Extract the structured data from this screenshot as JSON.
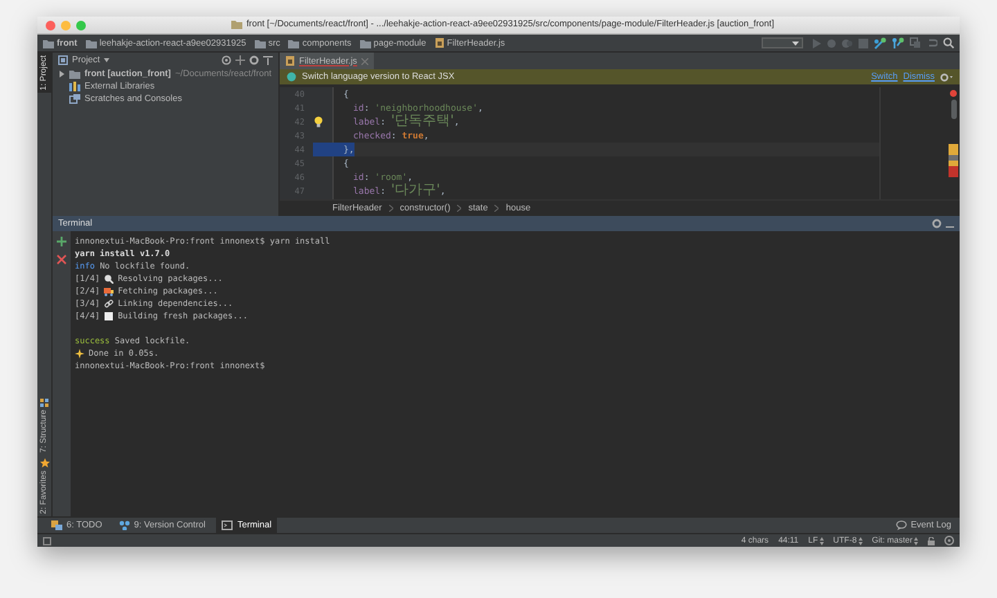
{
  "window": {
    "title": "front [~/Documents/react/front] - .../leehakje-action-react-a9ee02931925/src/components/page-module/FilterHeader.js [auction_front]"
  },
  "navigation_bar": [
    "front",
    "leehakje-action-react-a9ee02931925",
    "src",
    "components",
    "page-module",
    "FilterHeader.js"
  ],
  "left_strip": [
    {
      "label": "1: Project",
      "selected": true
    },
    {
      "label": "7: Structure",
      "selected": false
    },
    {
      "label": "2: Favorites",
      "selected": false
    }
  ],
  "project_panel": {
    "title": "Project",
    "items": [
      {
        "label": "front [auction_front]",
        "path": "~/Documents/react/front",
        "expanded": false,
        "kind": "folder"
      },
      {
        "label": "External Libraries",
        "kind": "library"
      },
      {
        "label": "Scratches and Consoles",
        "kind": "scratch"
      }
    ]
  },
  "editor": {
    "tabs": [
      {
        "label": "FilterHeader.js",
        "selected": true
      }
    ],
    "notification": {
      "text": "Switch language version to React JSX",
      "actions": [
        "Switch",
        "Dismiss"
      ]
    },
    "lines": [
      {
        "number": "40",
        "kind": "brace",
        "tokens": [
          {
            "kind": "punct",
            "text": "{"
          }
        ]
      },
      {
        "number": "41",
        "kind": "property",
        "tokens": [
          {
            "kind": "prop",
            "text": "id"
          },
          {
            "kind": "punct",
            "text": ": "
          },
          {
            "kind": "string",
            "text": "'neighborhoodhouse'"
          },
          {
            "kind": "punct",
            "text": ","
          }
        ]
      },
      {
        "number": "42",
        "kind": "property",
        "tokens": [
          {
            "kind": "prop",
            "text": "label"
          },
          {
            "kind": "punct",
            "text": ": "
          },
          {
            "kind": "string",
            "text": "'단독주택'"
          },
          {
            "kind": "punct",
            "text": ","
          }
        ],
        "bulb": true
      },
      {
        "number": "43",
        "kind": "property",
        "tokens": [
          {
            "kind": "prop",
            "text": "checked"
          },
          {
            "kind": "punct",
            "text": ": "
          },
          {
            "kind": "keyword",
            "text": "true"
          },
          {
            "kind": "punct",
            "text": ","
          }
        ]
      },
      {
        "number": "44",
        "kind": "brace",
        "tokens": [
          {
            "kind": "punct",
            "text": "},"
          }
        ],
        "highlighted": true
      },
      {
        "number": "45",
        "kind": "brace",
        "tokens": [
          {
            "kind": "punct",
            "text": "{"
          }
        ]
      },
      {
        "number": "46",
        "kind": "property",
        "tokens": [
          {
            "kind": "prop",
            "text": "id"
          },
          {
            "kind": "punct",
            "text": ": "
          },
          {
            "kind": "string",
            "text": "'room'"
          },
          {
            "kind": "punct",
            "text": ","
          }
        ]
      },
      {
        "number": "47",
        "kind": "property",
        "tokens": [
          {
            "kind": "prop",
            "text": "label"
          },
          {
            "kind": "punct",
            "text": ": "
          },
          {
            "kind": "string",
            "text": "'다가구'"
          },
          {
            "kind": "punct",
            "text": ","
          }
        ]
      }
    ],
    "breadcrumb": [
      "FilterHeader",
      "constructor()",
      "state",
      "house"
    ]
  },
  "terminal": {
    "title": "Terminal",
    "lines": [
      {
        "kind": "command",
        "text": "innonextui-MacBook-Pro:front innonext$ yarn install"
      },
      {
        "kind": "header",
        "text": "yarn install v1.7.0"
      },
      {
        "kind": "info",
        "label": "info",
        "text": " No lockfile found."
      },
      {
        "kind": "resolve",
        "step": "[1/4]",
        "text": "Resolving packages..."
      },
      {
        "kind": "fetch",
        "step": "[2/4]",
        "text": "Fetching packages..."
      },
      {
        "kind": "link",
        "step": "[3/4]",
        "text": "Linking dependencies..."
      },
      {
        "kind": "build",
        "step": "[4/4]",
        "text": "Building fresh packages..."
      },
      {
        "kind": "success",
        "label": "success",
        "text": " Saved lockfile."
      },
      {
        "kind": "done",
        "text": "Done in 0.05s."
      },
      {
        "kind": "command",
        "text": "innonextui-MacBook-Pro:front innonext$"
      }
    ]
  },
  "tool_tabs": [
    {
      "label": "6: TODO",
      "kind": "todo",
      "selected": false
    },
    {
      "label": "9: Version Control",
      "kind": "vcs",
      "selected": false
    },
    {
      "label": "Terminal",
      "kind": "terminal",
      "selected": true
    }
  ],
  "event_log": "Event Log",
  "status_bar": {
    "chars": "4 chars",
    "position": "44:11",
    "line_separator": "LF",
    "encoding": "UTF-8",
    "vcs": "Git: master"
  }
}
